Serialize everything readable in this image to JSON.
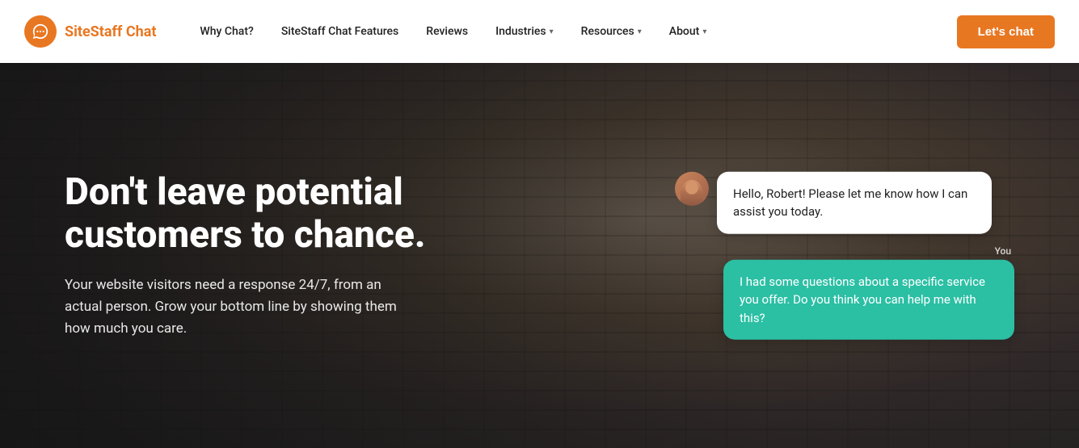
{
  "navbar": {
    "logo_icon": "💬",
    "logo_text_part1": "SiteStaff",
    "logo_text_part2": " Chat",
    "nav_items": [
      {
        "label": "Why Chat?",
        "has_dropdown": false
      },
      {
        "label": "SiteStaff Chat Features",
        "has_dropdown": false
      },
      {
        "label": "Reviews",
        "has_dropdown": false
      },
      {
        "label": "Industries",
        "has_dropdown": true
      },
      {
        "label": "Resources",
        "has_dropdown": true
      },
      {
        "label": "About",
        "has_dropdown": true
      }
    ],
    "cta_label": "Let's chat"
  },
  "hero": {
    "title": "Don't leave potential customers to chance.",
    "subtitle": "Your website visitors need a response 24/7, from an actual person. Grow your bottom line by showing them how much you care."
  },
  "chat": {
    "agent_message": "Hello, Robert! Please let me know how I can assist you today.",
    "you_label": "You",
    "user_message": "I had some questions about a specific service you offer. Do you think you can help me with this?"
  }
}
